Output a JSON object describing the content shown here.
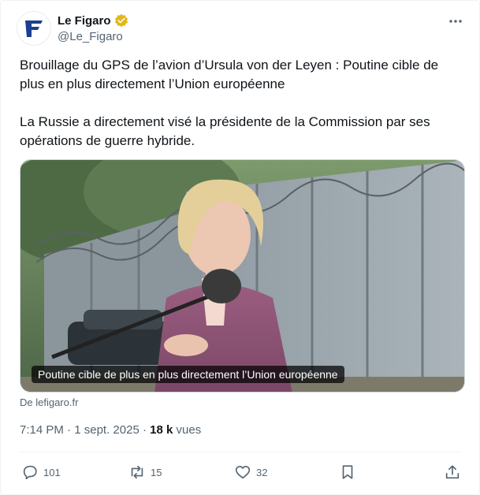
{
  "account": {
    "name": "Le Figaro",
    "handle": "@Le_Figaro",
    "avatar_letter": "F",
    "verified_color": "#e2b719"
  },
  "tweet": {
    "paragraph1": "Brouillage du GPS de l’avion d’Ursula von der Leyen : Poutine cible de plus en plus directement l’Union européenne",
    "paragraph2": "La Russie a directement visé la présidente de la Commission par ses opérations de guerre hybride."
  },
  "media": {
    "caption": "Poutine cible de plus en plus directement l’Union européenne"
  },
  "source": "De lefigaro.fr",
  "meta": {
    "time": "7:14 PM",
    "separator": "·",
    "date": "1 sept. 2025",
    "views_count": "18 k",
    "views_label": "vues"
  },
  "actions": {
    "replies": "101",
    "reposts": "15",
    "likes": "32"
  },
  "icons": [
    "verified-badge-icon",
    "more-options-icon",
    "reply-icon",
    "repost-icon",
    "like-icon",
    "bookmark-icon",
    "share-icon"
  ],
  "colors": {
    "text": "#0f1419",
    "secondary": "#536471",
    "brand": "#1a3f8f"
  }
}
